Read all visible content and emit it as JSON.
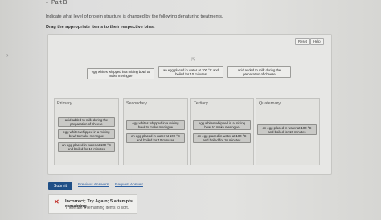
{
  "header": {
    "part_label": "Part B",
    "question": "Indicate what level of protein structure is changed by the following denaturing treatments.",
    "instruction": "Drag the appropriate items to their respective bins."
  },
  "toolbar": {
    "reset_label": "Reset",
    "help_label": "Help"
  },
  "source_items": [
    "egg whites whipped in a mixing bowl to make meringue",
    "an egg placed in water at 100 °C and boiled for 10 minutes",
    "acid added to milk during the preparation of cheese"
  ],
  "bins": [
    {
      "label": "Primary",
      "items": [
        "acid added to milk during the preparation of cheese",
        "egg whites whipped in a mixing bowl to make meringue",
        "an egg placed in water at 100 °C and boiled for 10 minutes"
      ]
    },
    {
      "label": "Secondary",
      "items": [
        "egg whites whipped in a mixing bowl to make meringue",
        "an egg placed in water at 100 °C and boiled for 10 minutes"
      ]
    },
    {
      "label": "Tertiary",
      "items": [
        "egg whites whipped in a mixing bowl to make meringue",
        "an egg placed in water at 100 °C and boiled for 10 minutes"
      ]
    },
    {
      "label": "Quaternary",
      "items": [
        "an egg placed in water at 100 °C and boiled for 10 minutes"
      ]
    }
  ],
  "actions": {
    "submit_label": "Submit",
    "previous_answers_label": "Previous Answers",
    "request_answer_label": "Request Answer"
  },
  "feedback": {
    "title": "Incorrect; Try Again; 5 attempts remaining",
    "text": "There are 6 remaining items to sort."
  },
  "colors": {
    "submit": "#1f4f86",
    "error": "#c0302a",
    "link": "#2a5d9f"
  }
}
